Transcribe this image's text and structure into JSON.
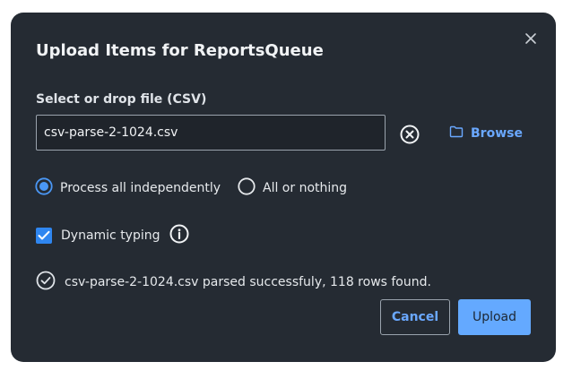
{
  "dialog": {
    "title": "Upload Items for ReportsQueue",
    "close_icon": "close-icon",
    "file": {
      "label": "Select or drop file (CSV)",
      "value": "csv-parse-2-1024.csv",
      "clear_icon": "clear-circle-x-icon",
      "browse_icon": "folder-icon",
      "browse_label": "Browse"
    },
    "mode": {
      "options": [
        {
          "label": "Process all independently",
          "selected": true
        },
        {
          "label": "All or nothing",
          "selected": false
        }
      ]
    },
    "dynamic_typing": {
      "label": "Dynamic typing",
      "checked": true,
      "info_icon": "info-icon"
    },
    "status": {
      "icon": "check-circle-icon",
      "message": "csv-parse-2-1024.csv parsed successfuly, 118 rows found."
    },
    "actions": {
      "cancel_label": "Cancel",
      "upload_label": "Upload"
    },
    "colors": {
      "background": "#252b33",
      "accent": "#64a9ff",
      "link": "#6aa8ff",
      "checkbox": "#2f86f0"
    }
  }
}
